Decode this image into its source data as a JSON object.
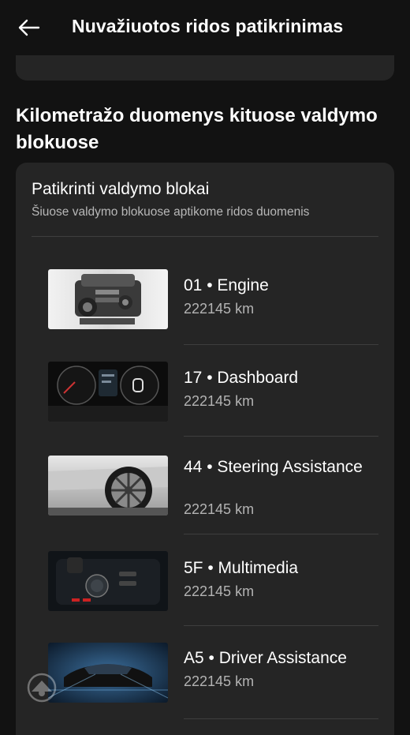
{
  "header": {
    "title": "Nuvažiuotos ridos patikrinimas",
    "back_icon": "arrow-left-icon"
  },
  "section": {
    "title": "Kilometražo duomenys kituose valdymo blokuose"
  },
  "card": {
    "title": "Patikrinti valdymo blokai",
    "subtitle": "Šiuose valdymo blokuose aptikome ridos duomenis"
  },
  "modules": [
    {
      "name": "01 • Engine",
      "km": "222145 km",
      "image": "engine-image"
    },
    {
      "name": "17 • Dashboard",
      "km": "222145 km",
      "image": "dashboard-image"
    },
    {
      "name": "44 • Steering Assistance",
      "km": "222145 km",
      "image": "wheel-image"
    },
    {
      "name": "5F • Multimedia",
      "km": "222145 km",
      "image": "multimedia-image"
    },
    {
      "name": "A5 • Driver Assistance",
      "km": "222145 km",
      "image": "driver-assistance-image"
    }
  ],
  "colors": {
    "background": "#121212",
    "card": "#252525",
    "divider": "#3e3e3e",
    "subtitle": "#b8b8b8"
  }
}
